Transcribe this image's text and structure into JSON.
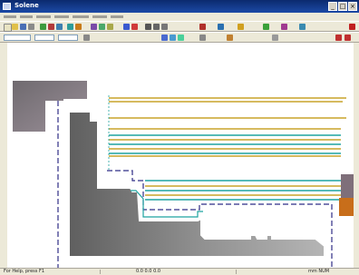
{
  "window": {
    "title": "Solene",
    "buttons": {
      "minimize": "_",
      "maximize": "□",
      "close": "×"
    }
  },
  "status": {
    "left": "For Help, press F1",
    "mid": "0.0  0.0  0.0",
    "right": "mm  NUM"
  },
  "colors": {
    "titlebar": "#0b2a6e",
    "toolpath_gold": "#c9a32a",
    "toolpath_teal": "#1fa3a0",
    "boundary_dash": "#2f2d86",
    "stock_orange": "#c86e1a"
  },
  "icons": [
    "new-icon",
    "open-icon",
    "save-icon",
    "print-icon",
    "cut-icon",
    "copy-icon",
    "paste-icon",
    "undo-icon",
    "redo-icon",
    "zoom-icon",
    "pan-icon",
    "rotate-icon",
    "layer-icon",
    "color-icon",
    "line-icon",
    "arc-icon",
    "circle-icon",
    "measure-icon",
    "help-icon"
  ]
}
